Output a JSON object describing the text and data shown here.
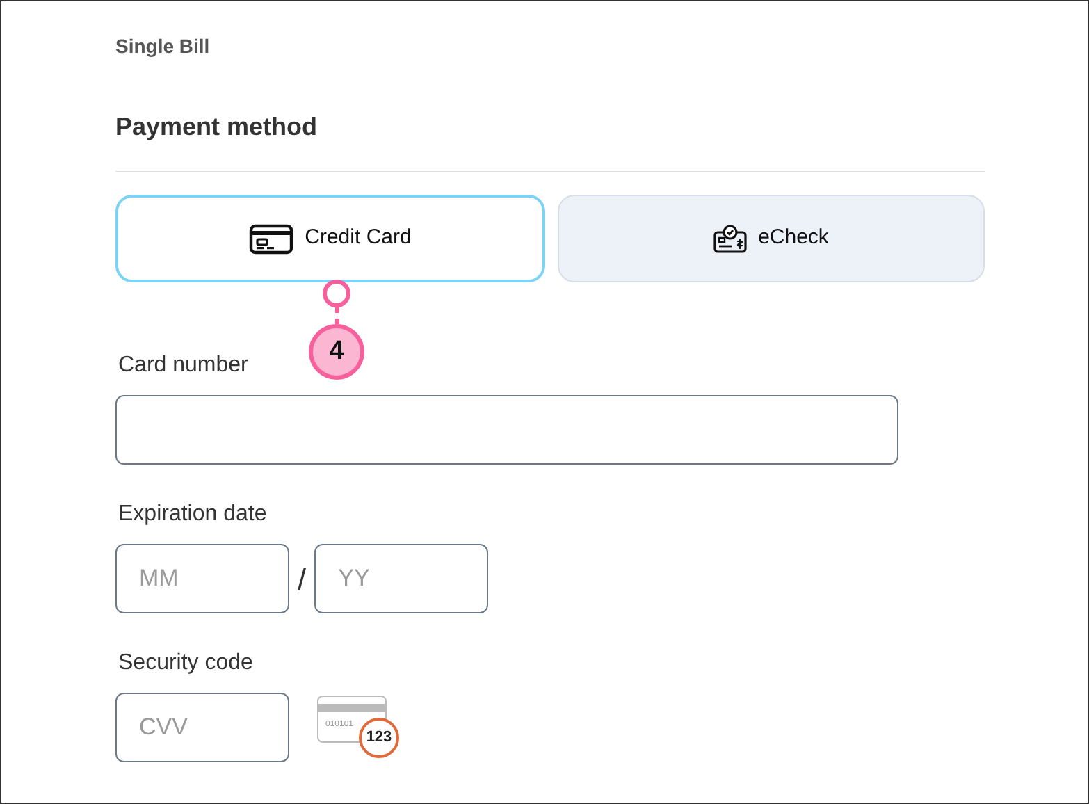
{
  "header": "Single Bill",
  "section_title": "Payment method",
  "tabs": [
    {
      "label": "Credit Card",
      "kind": "card",
      "selected": true
    },
    {
      "label": "eCheck",
      "kind": "check",
      "selected": false
    }
  ],
  "callout": {
    "label": "4"
  },
  "fields": [
    {
      "label": "Card number",
      "kind": "wide"
    },
    {
      "label": "Expiration date",
      "kind": "split",
      "separator": "/",
      "inputs": [
        {
          "placeholder": "MM"
        },
        {
          "placeholder": "YY"
        }
      ]
    },
    {
      "label": "Security code",
      "kind": "cvv",
      "inputs": [
        {
          "placeholder": "CVV"
        }
      ],
      "hint": {
        "digits": "010101",
        "code": "123"
      }
    }
  ]
}
